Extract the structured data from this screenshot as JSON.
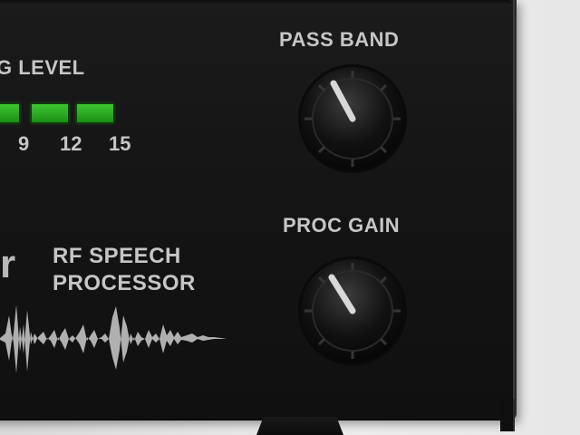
{
  "labels": {
    "level_partial": "G LEVEL",
    "pass_band": "PASS BAND",
    "proc_gain": "PROC GAIN",
    "brand_partial": "r",
    "product_line1": "RF SPEECH",
    "product_line2": "PROCESSOR"
  },
  "meter": {
    "ticks": [
      "9",
      "12",
      "15"
    ],
    "lit_segments": 3
  },
  "knobs": {
    "pass_band": {
      "pointer_angle_deg": -28
    },
    "proc_gain": {
      "pointer_angle_deg": -32
    }
  },
  "colors": {
    "panel": "#151515",
    "label": "#c6c6c6",
    "led_on": "#2fb426",
    "waveform": "#b0b0b0"
  }
}
